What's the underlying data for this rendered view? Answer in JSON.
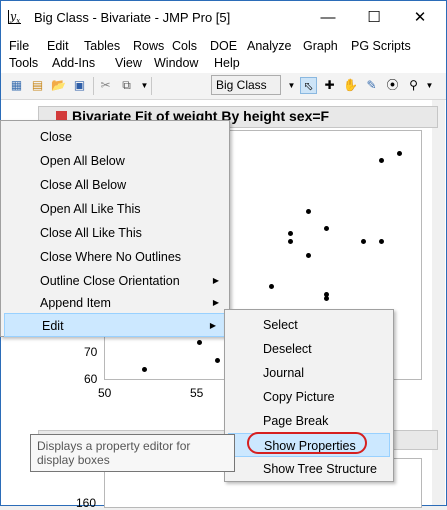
{
  "window": {
    "title": "Big Class - Bivariate - JMP Pro [5]",
    "app_icon": "jmp-icon",
    "minimize": "—",
    "maximize": "☐",
    "close": "✕"
  },
  "menubar": {
    "row1": [
      "File",
      "Edit",
      "Tables",
      "Rows",
      "Cols",
      "DOE",
      "Analyze",
      "Graph",
      "PG Scripts"
    ],
    "row2": [
      "Tools",
      "Add-Ins",
      "View",
      "Window",
      "Help"
    ]
  },
  "toolbar": {
    "table_select": "Big Class"
  },
  "report": {
    "outline_title": "Bivariate Fit of weight By height sex=F",
    "y_ticks": [
      "70",
      "60"
    ],
    "x_ticks": [
      "50",
      "55"
    ],
    "y_tick_lower": "160"
  },
  "context_menu": {
    "items": [
      {
        "label": "Close",
        "submenu": false
      },
      {
        "label": "Open All Below",
        "submenu": false
      },
      {
        "label": "Close All Below",
        "submenu": false
      },
      {
        "label": "Open All Like This",
        "submenu": false
      },
      {
        "label": "Close All Like This",
        "submenu": false
      },
      {
        "label": "Close Where No Outlines",
        "submenu": false
      },
      {
        "label": "Outline Close Orientation",
        "submenu": true
      },
      {
        "label": "Append Item",
        "submenu": true
      },
      {
        "label": "Edit",
        "submenu": true
      }
    ]
  },
  "submenu": {
    "items": [
      "Select",
      "Deselect",
      "Journal",
      "Copy Picture",
      "Page Break",
      "Show Properties",
      "Show Tree Structure"
    ],
    "highlighted": "Show Properties"
  },
  "tooltip": {
    "text": "Displays a property editor for display boxes"
  },
  "colors": {
    "highlight": "#cce8ff",
    "annotation_ring": "#d62020",
    "collapse_arrow": "#d23a3a"
  }
}
